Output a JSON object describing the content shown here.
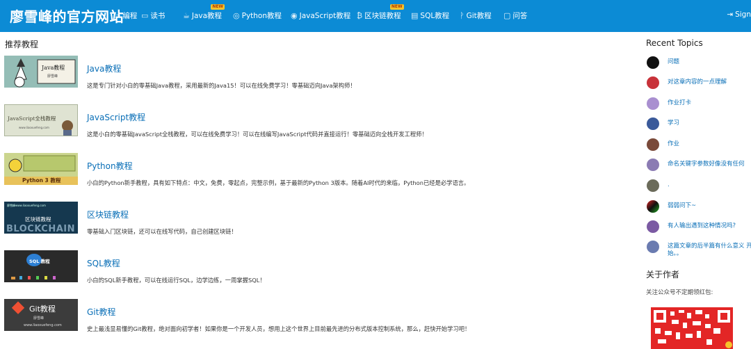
{
  "header": {
    "site_title": "廖雪峰的官方网站",
    "nav": [
      {
        "label": "编程",
        "icon": "code-icon",
        "new": false
      },
      {
        "label": "读书",
        "icon": "book-icon",
        "new": false
      },
      {
        "label": "Java教程",
        "icon": "coffee-icon",
        "new": true
      },
      {
        "label": "Python教程",
        "icon": "python-icon",
        "new": false
      },
      {
        "label": "JavaScript教程",
        "icon": "javascript-icon",
        "new": false
      },
      {
        "label": "区块链教程",
        "icon": "bitcoin-icon",
        "new": true
      },
      {
        "label": "SQL教程",
        "icon": "database-icon",
        "new": false
      },
      {
        "label": "Git教程",
        "icon": "git-branch-icon",
        "new": false
      },
      {
        "label": "问答",
        "icon": "comment-icon",
        "new": false
      }
    ],
    "new_badge": "NEW",
    "signin": "Sign"
  },
  "main": {
    "section_title": "推荐教程",
    "courses": [
      {
        "title": "Java教程",
        "desc": "这是专门针对小白的零基础Java教程，采用最新的Java15！可以在线免费学习！零基础迈向Java架构师！",
        "thumb_text": "Java教程",
        "thumb_sub": "廖雪峰"
      },
      {
        "title": "JavaScript教程",
        "desc": "这是小白的零基础JavaScript全栈教程，可以在线免费学习！可以在线编写JavaScript代码并直接运行！零基础迈向全栈开发工程师！",
        "thumb_text": "JavaScript全栈教程",
        "thumb_sub": "www.liaoxuefeng.com"
      },
      {
        "title": "Python教程",
        "desc": "小白的Python新手教程，具有如下特点：中文，免费，零起点，完整示例，基于最新的Python 3版本。随着AI时代的来临，Python已经是必学语言。",
        "thumb_text": "Python 3 教程",
        "thumb_sub": ""
      },
      {
        "title": "区块链教程",
        "desc": "零基础入门区块链，还可以在线写代码，自己创建区块链！",
        "thumb_text": "区块链教程",
        "thumb_sub": "BLOCKCHAIN",
        "thumb_top": "廖雪峰www.liaoxuefeng.com"
      },
      {
        "title": "SQL教程",
        "desc": "小白的SQL新手教程，可以在线运行SQL，边学边练，一周掌握SQL！",
        "thumb_text": "SQL 教程",
        "thumb_sub": ""
      },
      {
        "title": "Git教程",
        "desc": "史上最浅显易懂的Git教程，绝对面向初学者！如果你是一个开发人员，想用上这个世界上目前最先进的分布式版本控制系统，那么，赶快开始学习吧！",
        "thumb_text": "Git教程",
        "thumb_sub": "廖雪峰",
        "thumb_url": "www.liaoxuefeng.com"
      }
    ]
  },
  "sidebar": {
    "recent_heading": "Recent Topics",
    "topics": [
      {
        "text": "问题",
        "avatar_color": "#111111"
      },
      {
        "text": "对这章内容的一点理解",
        "avatar_color": "#c8323a"
      },
      {
        "text": "作业打卡",
        "avatar_color": "#a98fd0"
      },
      {
        "text": "学习",
        "avatar_color": "#3b5a9a"
      },
      {
        "text": "作业",
        "avatar_color": "#7a4a3a"
      },
      {
        "text": "命名关键字参数好像没有任何",
        "avatar_color": "#8b7bb3"
      },
      {
        "text": ".",
        "avatar_color": "#6b6b5a"
      },
      {
        "text": "弱弱问下~",
        "avatar_color": "#2a6b3a"
      },
      {
        "text": "有人输出遇到这种情况吗?",
        "avatar_color": "#7b5aa3"
      },
      {
        "text": "这篇文章的后半篇有什么意义 开始。。",
        "avatar_color": "#6a7bb0"
      }
    ],
    "author_heading": "关于作者",
    "follow_text": "关注公众号不定期领红包:"
  }
}
